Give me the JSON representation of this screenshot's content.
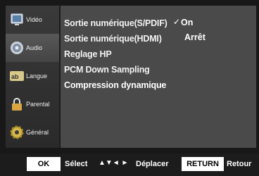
{
  "sidebar": {
    "items": [
      {
        "label": "Vidéo",
        "icon": "video-icon"
      },
      {
        "label": "Audio",
        "icon": "speaker-icon"
      },
      {
        "label": "Langue",
        "icon": "language-icon"
      },
      {
        "label": "Parental",
        "icon": "lock-icon"
      },
      {
        "label": "Général",
        "icon": "gear-icon"
      }
    ],
    "active": "Audio"
  },
  "menu": {
    "items": [
      "Sortie numérique(S/PDIF)",
      "Sortie numérique(HDMI)",
      "Reglage HP",
      "PCM Down Sampling",
      "Compression dynamique"
    ]
  },
  "options": {
    "check": "✓",
    "items": [
      "On",
      "Arrêt"
    ],
    "selected": "On"
  },
  "footer": {
    "ok_key": "OK",
    "select_label": "Sélect",
    "arrows": "▲▼◄ ►",
    "move_label": "Déplacer",
    "return_key": "RETURN",
    "return_label": "Retour"
  },
  "colors": {
    "panel": "#4a4a4a",
    "sidebar": "#333333",
    "background": "#181818",
    "text": "#ffffff"
  }
}
